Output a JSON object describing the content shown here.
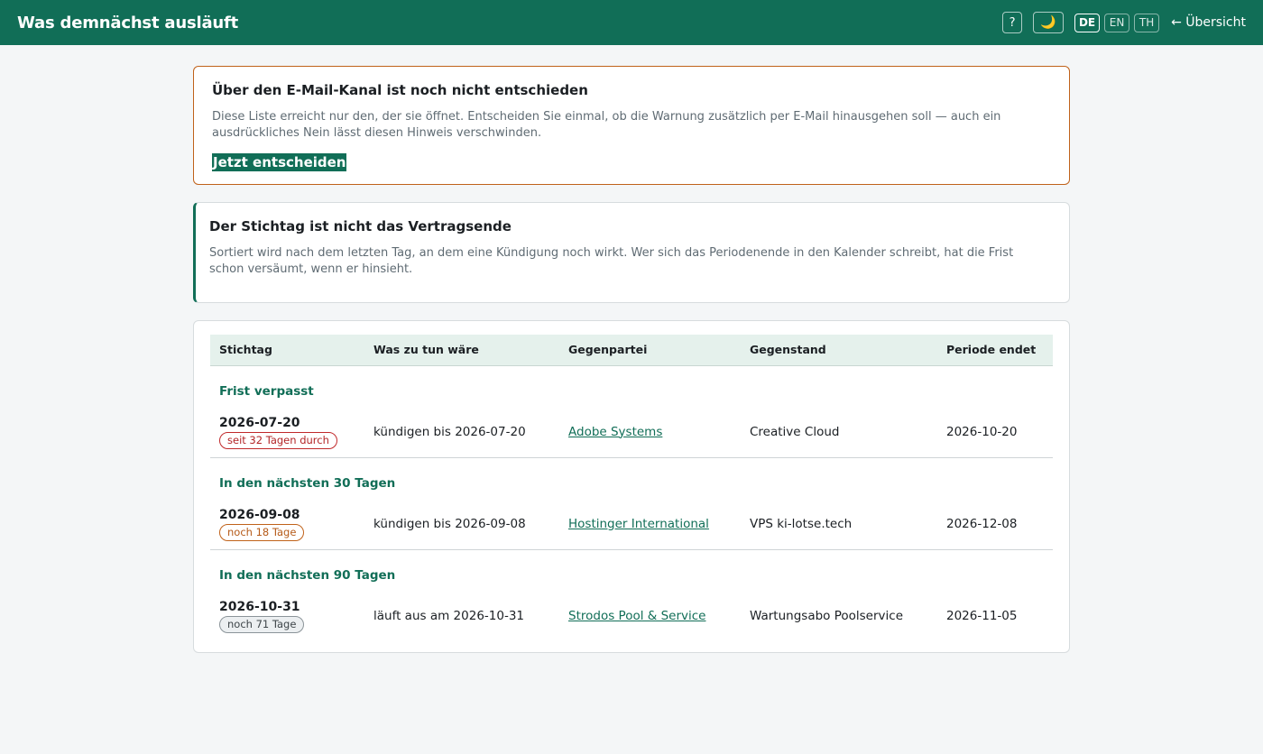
{
  "header": {
    "title": "Was demnächst ausläuft",
    "help_label": "?",
    "theme_label": "🌙",
    "languages": [
      "DE",
      "EN",
      "TH"
    ],
    "active_language": "DE",
    "overview_label": "← Übersicht"
  },
  "email_notice": {
    "title": "Über den E-Mail-Kanal ist noch nicht entschieden",
    "text": "Diese Liste erreicht nur den, der sie öffnet. Entscheiden Sie einmal, ob die Warnung zusätzlich per E-Mail hinausgehen soll — auch ein ausdrückliches Nein lässt diesen Hinweis verschwinden.",
    "cta_label": "Jetzt entscheiden"
  },
  "deadline_info": {
    "title": "Der Stichtag ist nicht das Vertragsende",
    "text": "Sortiert wird nach dem letzten Tag, an dem eine Kündigung noch wirkt. Wer sich das Periodenende in den Kalender schreibt, hat die Frist schon versäumt, wenn er hinsieht."
  },
  "table": {
    "columns": [
      "Stichtag",
      "Was zu tun wäre",
      "Gegenpartei",
      "Gegenstand",
      "Periode endet"
    ],
    "groups": [
      {
        "label": "Frist verpasst",
        "rows": [
          {
            "date": "2026-07-20",
            "badge": "seit 32 Tagen durch",
            "action": "kündigen bis 2026-07-20",
            "party": "Adobe Systems",
            "subject": "Creative Cloud",
            "period_end": "2026-10-20"
          }
        ]
      },
      {
        "label": "In den nächsten 30 Tagen",
        "rows": [
          {
            "date": "2026-09-08",
            "badge": "noch 18 Tage",
            "action": "kündigen bis 2026-09-08",
            "party": "Hostinger International",
            "subject": "VPS ki-lotse.tech",
            "period_end": "2026-12-08"
          }
        ]
      },
      {
        "label": "In den nächsten 90 Tagen",
        "rows": [
          {
            "date": "2026-10-31",
            "badge": "noch 71 Tage",
            "action": "läuft aus am 2026-10-31",
            "party": "Strodos Pool & Service",
            "subject": "Wartungsabo Poolservice",
            "period_end": "2026-11-05"
          }
        ]
      }
    ]
  },
  "colors": {
    "brand": "#116e57",
    "warning": "#c0621a",
    "danger": "#c0292b"
  }
}
